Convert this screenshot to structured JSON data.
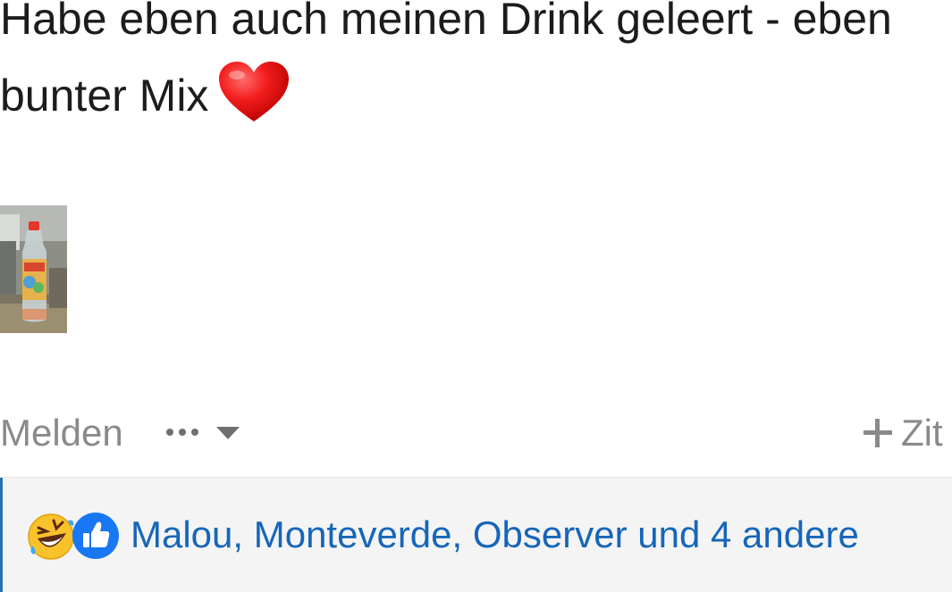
{
  "post": {
    "line1": "Habe eben auch meinen Drink geleert - eben",
    "line2": "bunter Mix",
    "emoji": "heart-icon"
  },
  "attachment": {
    "type": "photo-thumbnail",
    "icon": "bottle-photo"
  },
  "actions": {
    "report_label": "Melden",
    "more_icon": "ellipsis-icon",
    "quote_label": "Zit"
  },
  "reactions": {
    "icons": [
      "rolling-laughing-icon",
      "thumbs-up-icon"
    ],
    "users_text": "Malou, Monteverde, Observer und 4 andere"
  },
  "colors": {
    "link_blue": "#1666b8",
    "muted_text": "#8a8a8a",
    "reaction_bg": "#f4f4f5",
    "heart_red": "#e8191b"
  }
}
